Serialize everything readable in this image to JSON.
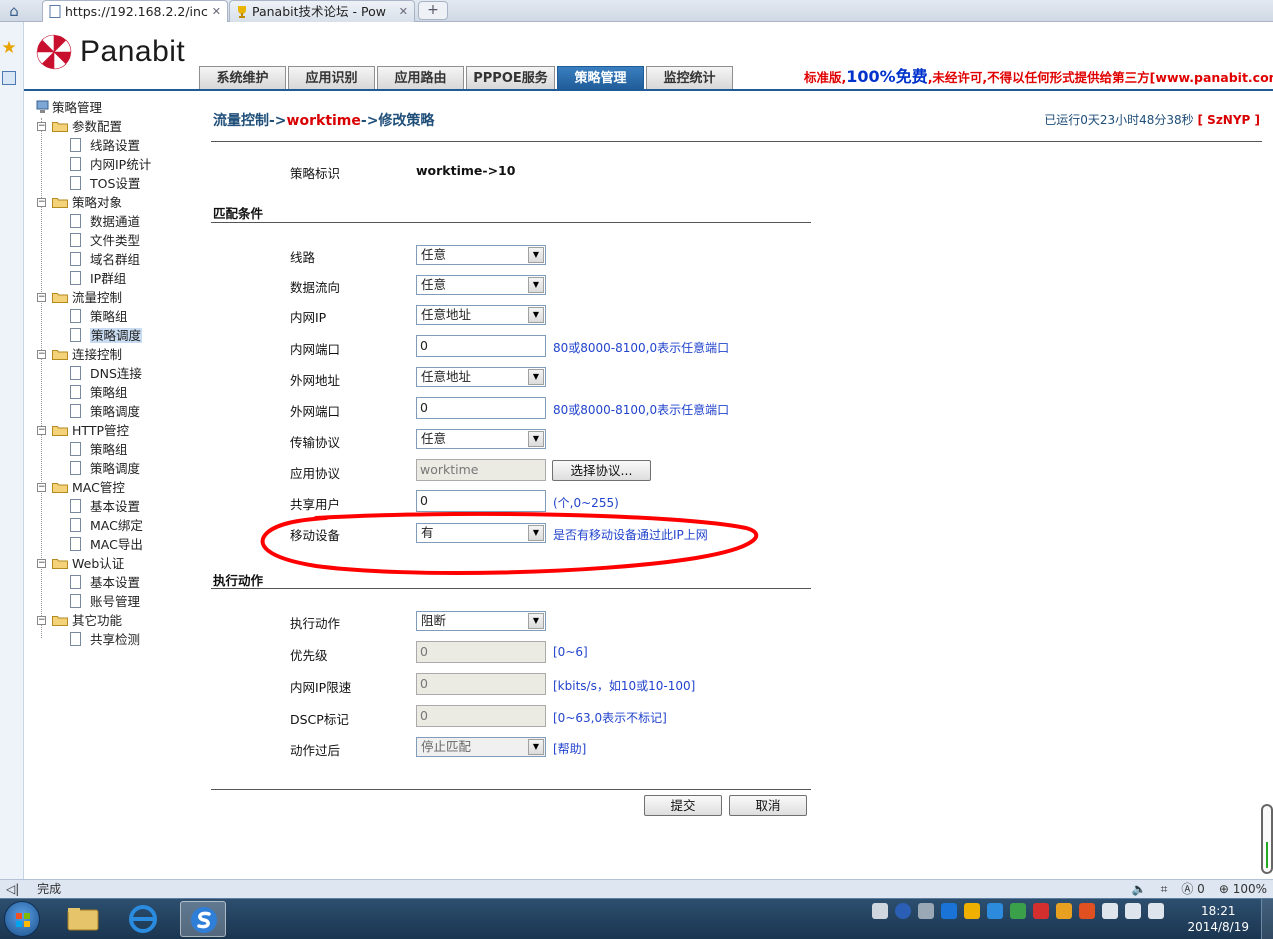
{
  "browser": {
    "tabs": [
      {
        "title": "https://192.168.2.2/inc",
        "close": "✕"
      },
      {
        "title": "Panabit技术论坛 - Pow",
        "close": "✕"
      }
    ],
    "new_tab": "+"
  },
  "header": {
    "logo_text": "Panabit",
    "notice_part1": "标准版,",
    "notice_big": "100%免费",
    "notice_part2": ",未经许可,不得以任何形式提供给第三方[www.panabit.com]!",
    "nav": [
      "系统维护",
      "应用识别",
      "应用路由",
      "PPPOE服务",
      "策略管理",
      "监控统计"
    ],
    "nav_active": "策略管理"
  },
  "tree": {
    "root": "策略管理",
    "groups": [
      {
        "label": "参数配置",
        "items": [
          "线路设置",
          "内网IP统计",
          "TOS设置"
        ]
      },
      {
        "label": "策略对象",
        "items": [
          "数据通道",
          "文件类型",
          "域名群组",
          "IP群组"
        ]
      },
      {
        "label": "流量控制",
        "items": [
          "策略组",
          "策略调度"
        ]
      },
      {
        "label": "连接控制",
        "items": [
          "DNS连接",
          "策略组",
          "策略调度"
        ]
      },
      {
        "label": "HTTP管控",
        "items": [
          "策略组",
          "策略调度"
        ]
      },
      {
        "label": "MAC管控",
        "items": [
          "基本设置",
          "MAC绑定",
          "MAC导出"
        ]
      },
      {
        "label": "Web认证",
        "items": [
          "基本设置",
          "账号管理"
        ]
      },
      {
        "label": "其它功能",
        "items": [
          "共享检测"
        ]
      }
    ],
    "toggle": "−"
  },
  "content": {
    "breadcrumb": {
      "part1": "流量控制->",
      "part2": "worktime",
      "part3": "->修改策略"
    },
    "uptime": {
      "text": "已运行0天23小时48分38秒",
      "badge": "[ SzNYP ]"
    },
    "policy_id_label": "策略标识",
    "policy_id_value": "worktime->10",
    "section_match": "匹配条件",
    "section_action": "执行动作",
    "fields": {
      "line": {
        "label": "线路",
        "value": "任意"
      },
      "direction": {
        "label": "数据流向",
        "value": "任意"
      },
      "inner_ip": {
        "label": "内网IP",
        "value": "任意地址"
      },
      "inner_port": {
        "label": "内网端口",
        "value": "0",
        "hint": "80或8000-8100,0表示任意端口"
      },
      "outer_addr": {
        "label": "外网地址",
        "value": "任意地址"
      },
      "outer_port": {
        "label": "外网端口",
        "value": "0",
        "hint": "80或8000-8100,0表示任意端口"
      },
      "transport": {
        "label": "传输协议",
        "value": "任意"
      },
      "app_proto": {
        "label": "应用协议",
        "value": "worktime",
        "button": "选择协议..."
      },
      "shared_users": {
        "label": "共享用户",
        "value": "0",
        "hint": "(个,0~255)"
      },
      "mobile": {
        "label": "移动设备",
        "value": "有",
        "hint": "是否有移动设备通过此IP上网"
      },
      "action": {
        "label": "执行动作",
        "value": "阻断"
      },
      "priority": {
        "label": "优先级",
        "value": "0",
        "hint": "[0~6]"
      },
      "rate_limit": {
        "label": "内网IP限速",
        "value": "0",
        "hint": "[kbits/s，如10或10-100]"
      },
      "dscp": {
        "label": "DSCP标记",
        "value": "0",
        "hint": "[0~63,0表示不标记]"
      },
      "after": {
        "label": "动作过后",
        "value": "停止匹配",
        "hint": "[帮助]"
      }
    },
    "submit": "提交",
    "cancel": "取消"
  },
  "statusbar": {
    "left": "完成",
    "zoom": "100%",
    "counter": "0"
  },
  "taskbar": {
    "time": "18:21",
    "date": "2014/8/19"
  },
  "colors": {
    "brand_blue": "#1f5b97",
    "breadcrumb": "#1f4e79",
    "accent_red": "#d80000",
    "hint_blue": "#2244cc",
    "annotation_red": "#ff0000"
  }
}
